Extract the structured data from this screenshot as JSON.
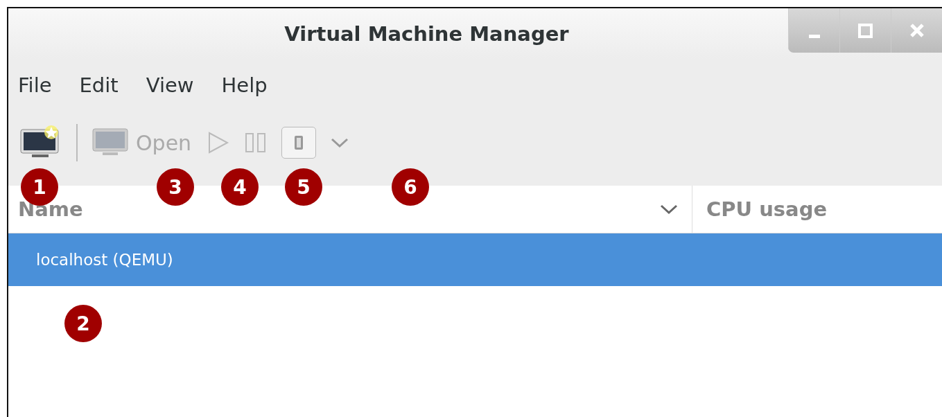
{
  "window": {
    "title": "Virtual Machine Manager"
  },
  "menu": [
    {
      "label": "File"
    },
    {
      "label": "Edit"
    },
    {
      "label": "View"
    },
    {
      "label": "Help"
    }
  ],
  "toolbar": {
    "open_label": "Open",
    "disabled": true
  },
  "table": {
    "columns": [
      {
        "label": "Name"
      },
      {
        "label": "CPU usage"
      }
    ],
    "rows": [
      {
        "name": "localhost (QEMU)",
        "selected": true
      }
    ]
  },
  "callouts": [
    {
      "label": "1"
    },
    {
      "label": "3"
    },
    {
      "label": "4"
    },
    {
      "label": "5"
    },
    {
      "label": "6"
    },
    {
      "label": "2"
    }
  ]
}
